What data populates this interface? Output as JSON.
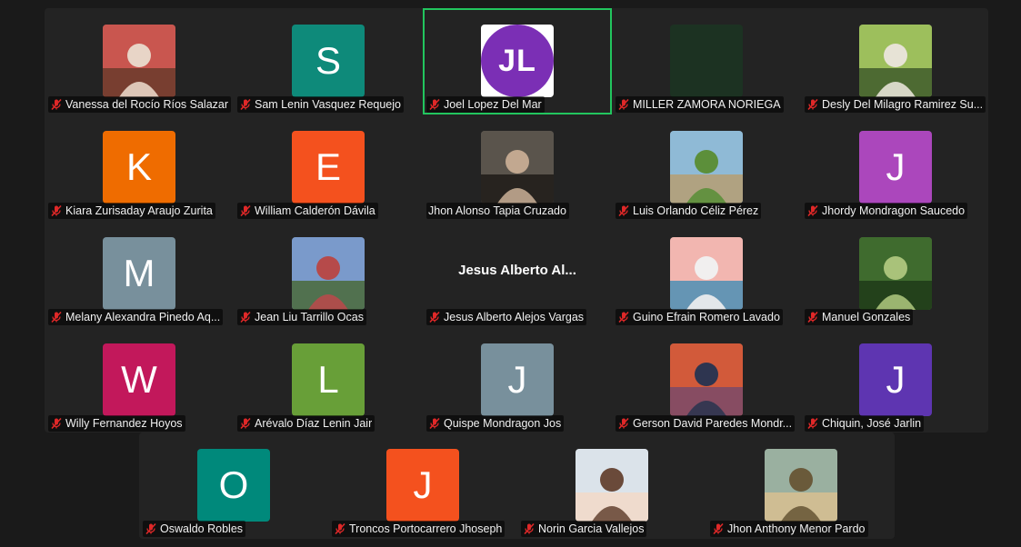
{
  "colors": {
    "background": "#1a1a1a",
    "panel": "#232323",
    "active_speaker_border": "#22c55e",
    "muted_icon": "#e02828"
  },
  "participants": [
    {
      "name": "Vanessa del Rocío Ríos Salazar",
      "avatar_type": "photo",
      "photo_palette": [
        "#c9564f",
        "#e8d5c7",
        "#6a3a2a"
      ],
      "muted": true
    },
    {
      "name": "Sam Lenin Vasquez Requejo",
      "avatar_type": "initial",
      "initial": "S",
      "color": "#0e8a7a",
      "muted": true
    },
    {
      "name": "Joel Lopez Del Mar",
      "avatar_type": "initials-circle",
      "initial": "JL",
      "color": "#7b2fb5",
      "muted": true,
      "active": true
    },
    {
      "name": "MILLER ZAMORA NORIEGA",
      "avatar_type": "blank",
      "muted": true
    },
    {
      "name": "Desly Del Milagro Ramirez Su...",
      "avatar_type": "photo",
      "photo_palette": [
        "#9dbf5c",
        "#e7e3d6",
        "#3f5a2a"
      ],
      "muted": true
    },
    {
      "name": "Kiara Zurisaday Araujo Zurita",
      "avatar_type": "initial",
      "initial": "K",
      "color": "#ef6c00",
      "muted": true
    },
    {
      "name": "William Calderón Dávila",
      "avatar_type": "initial",
      "initial": "E",
      "color": "#f4511e",
      "muted": true
    },
    {
      "name": "Jhon Alonso Tapia Cruzado",
      "avatar_type": "photo",
      "photo_palette": [
        "#5a544c",
        "#c2a890",
        "#1e1b18"
      ],
      "muted": false
    },
    {
      "name": "Luis Orlando Céliz Pérez",
      "avatar_type": "photo",
      "photo_palette": [
        "#8fbad6",
        "#5c8f3a",
        "#b69d72"
      ],
      "muted": true
    },
    {
      "name": "Jhordy Mondragon Saucedo",
      "avatar_type": "initial",
      "initial": "J",
      "color": "#ab47bc",
      "muted": true
    },
    {
      "name": "Melany Alexandra Pinedo Aq...",
      "avatar_type": "initial",
      "initial": "M",
      "color": "#78909c",
      "muted": true
    },
    {
      "name": "Jean Liu Tarrillo Ocas",
      "avatar_type": "photo",
      "photo_palette": [
        "#7a9acb",
        "#b64a4a",
        "#4a6a3a"
      ],
      "muted": true
    },
    {
      "name": "Jesus Alberto Alejos Vargas",
      "avatar_type": "name-banner",
      "banner": "Jesus Alberto Al...",
      "muted": true
    },
    {
      "name": "Guino Efrain Romero Lavado",
      "avatar_type": "photo",
      "photo_palette": [
        "#f2b6b0",
        "#f1efef",
        "#4c8fb5"
      ],
      "muted": true
    },
    {
      "name": "Manuel Gonzales",
      "avatar_type": "photo",
      "photo_palette": [
        "#3f6b2e",
        "#a9c27a",
        "#1f3a18"
      ],
      "muted": true
    },
    {
      "name": "Willy Fernandez Hoyos",
      "avatar_type": "initial",
      "initial": "W",
      "color": "#c2185b",
      "muted": true
    },
    {
      "name": "Arévalo Díaz Lenin Jair",
      "avatar_type": "initial",
      "initial": "L",
      "color": "#689f38",
      "muted": true
    },
    {
      "name": "Quispe Mondragon Jos",
      "avatar_type": "initial",
      "initial": "J",
      "color": "#78909c",
      "muted": true
    },
    {
      "name": "Gerson David Paredes Mondr...",
      "avatar_type": "photo",
      "photo_palette": [
        "#d25a3a",
        "#2e3550",
        "#7a4a6a"
      ],
      "muted": true
    },
    {
      "name": "Chiquin, José Jarlin",
      "avatar_type": "initial",
      "initial": "J",
      "color": "#5e35b1",
      "muted": true
    }
  ],
  "last_row": [
    {
      "name": "Oswaldo Robles",
      "avatar_type": "initial",
      "initial": "O",
      "color": "#00897b",
      "muted": true
    },
    {
      "name": "Troncos Portocarrero Jhoseph",
      "avatar_type": "initial",
      "initial": "J",
      "color": "#f4511e",
      "muted": true
    },
    {
      "name": "Norin Garcia Vallejos",
      "avatar_type": "photo",
      "photo_palette": [
        "#dbe3ea",
        "#6a4a3a",
        "#f2d9c8"
      ],
      "muted": true
    },
    {
      "name": "Jhon Anthony Menor Pardo",
      "avatar_type": "photo",
      "photo_palette": [
        "#9ab0a0",
        "#6a5a3a",
        "#d8c090"
      ],
      "muted": true
    }
  ]
}
